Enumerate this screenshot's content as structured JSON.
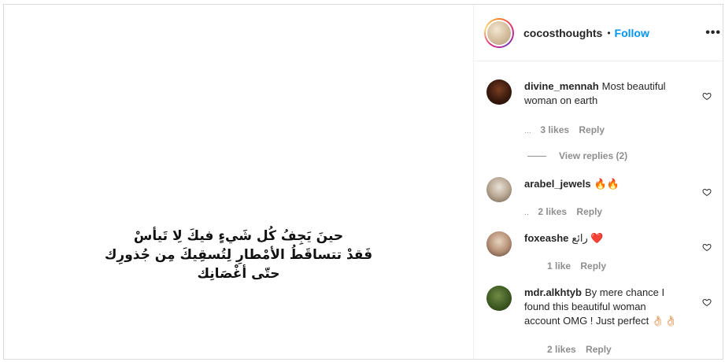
{
  "post": {
    "quote_lines": [
      "حينَ يَجِفُ كُل شَيءٍ فيكَ لِا تَيأسْ",
      "فَقدْ تتساقَطُ الأمْطارِ لِتُسقِيكَ مِن جُذورِك",
      "حتّى أغْصَانِك"
    ]
  },
  "header": {
    "username": "cocosthoughts",
    "separator": "•",
    "follow_label": "Follow",
    "more_label": "•••"
  },
  "comments": [
    {
      "username": "divine_mennah",
      "text": "Most beautiful woman on earth",
      "time": "…",
      "likes": "3 likes",
      "reply": "Reply",
      "view_replies": "View replies (2)"
    },
    {
      "username": "arabel_jewels",
      "text": "🔥🔥",
      "time": "‥",
      "likes": "2 likes",
      "reply": "Reply"
    },
    {
      "username": "foxeashe",
      "text": "رائع ❤️",
      "likes": "1 like",
      "reply": "Reply"
    },
    {
      "username": "mdr.alkhtyb",
      "text": "By mere chance I found this beautiful woman account OMG ! Just perfect 👌🏻👌🏻",
      "likes": "2 likes",
      "reply": "Reply"
    }
  ],
  "colors": {
    "follow": "#0095f6",
    "meta": "#8e8e8e",
    "border": "#dbdbdb"
  }
}
